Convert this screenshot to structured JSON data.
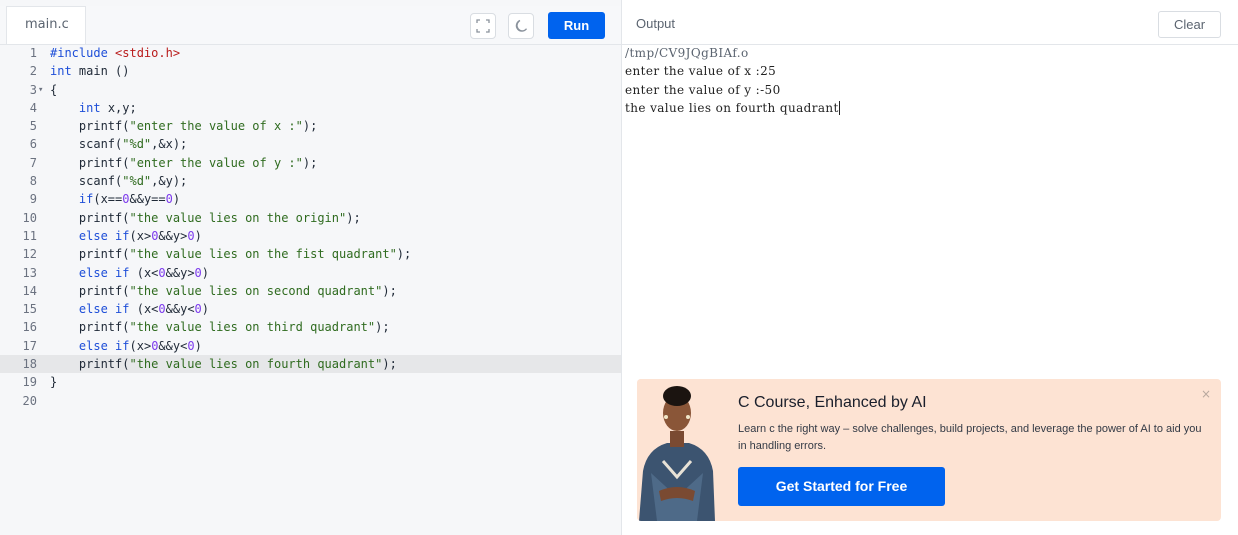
{
  "editor": {
    "file_tab": "main.c",
    "run_label": "Run",
    "icons": [
      "fullscreen-icon",
      "moon-icon"
    ],
    "lines": [
      {
        "num": "1",
        "fold": "",
        "text": "#include <stdio.h>"
      },
      {
        "num": "2",
        "fold": "",
        "text": "int main ()"
      },
      {
        "num": "3",
        "fold": "▾",
        "text": "{"
      },
      {
        "num": "4",
        "fold": "",
        "text": "    int x,y;"
      },
      {
        "num": "5",
        "fold": "",
        "text": "    printf(\"enter the value of x :\");"
      },
      {
        "num": "6",
        "fold": "",
        "text": "    scanf(\"%d\",&x);"
      },
      {
        "num": "7",
        "fold": "",
        "text": "    printf(\"enter the value of y :\");"
      },
      {
        "num": "8",
        "fold": "",
        "text": "    scanf(\"%d\",&y);"
      },
      {
        "num": "9",
        "fold": "",
        "text": "    if(x==0&&y==0)"
      },
      {
        "num": "10",
        "fold": "",
        "text": "    printf(\"the value lies on the origin\");"
      },
      {
        "num": "11",
        "fold": "",
        "text": "    else if(x>0&&y>0)"
      },
      {
        "num": "12",
        "fold": "",
        "text": "    printf(\"the value lies on the fist quadrant\");"
      },
      {
        "num": "13",
        "fold": "",
        "text": "    else if (x<0&&y>0)"
      },
      {
        "num": "14",
        "fold": "",
        "text": "    printf(\"the value lies on second quadrant\");"
      },
      {
        "num": "15",
        "fold": "",
        "text": "    else if (x<0&&y<0)"
      },
      {
        "num": "16",
        "fold": "",
        "text": "    printf(\"the value lies on third quadrant\");"
      },
      {
        "num": "17",
        "fold": "",
        "text": "    else if(x>0&&y<0)"
      },
      {
        "num": "18",
        "fold": "",
        "text": "    printf(\"the value lies on fourth quadrant\");"
      },
      {
        "num": "19",
        "fold": "",
        "text": "}"
      },
      {
        "num": "20",
        "fold": "",
        "text": ""
      }
    ],
    "active_line": 18
  },
  "output": {
    "title": "Output",
    "clear_label": "Clear",
    "lines": [
      "/tmp/CV9JQgBIAf.o",
      "enter the value of x :25",
      "enter the value of y :-50",
      "the value lies on fourth quadrant"
    ]
  },
  "promo": {
    "title": "C Course, Enhanced by AI",
    "text": "Learn c the right way – solve challenges, build projects, and leverage the power of AI to aid you in handling errors.",
    "button_label": "Get Started for Free",
    "close_glyph": "×"
  },
  "colors": {
    "accent": "#0063ee",
    "promo_bg": "#fde3d3",
    "keyword": "#1d4ed8",
    "string": "#2f6b1f",
    "include": "#b91c1c",
    "number": "#7c3aed"
  }
}
